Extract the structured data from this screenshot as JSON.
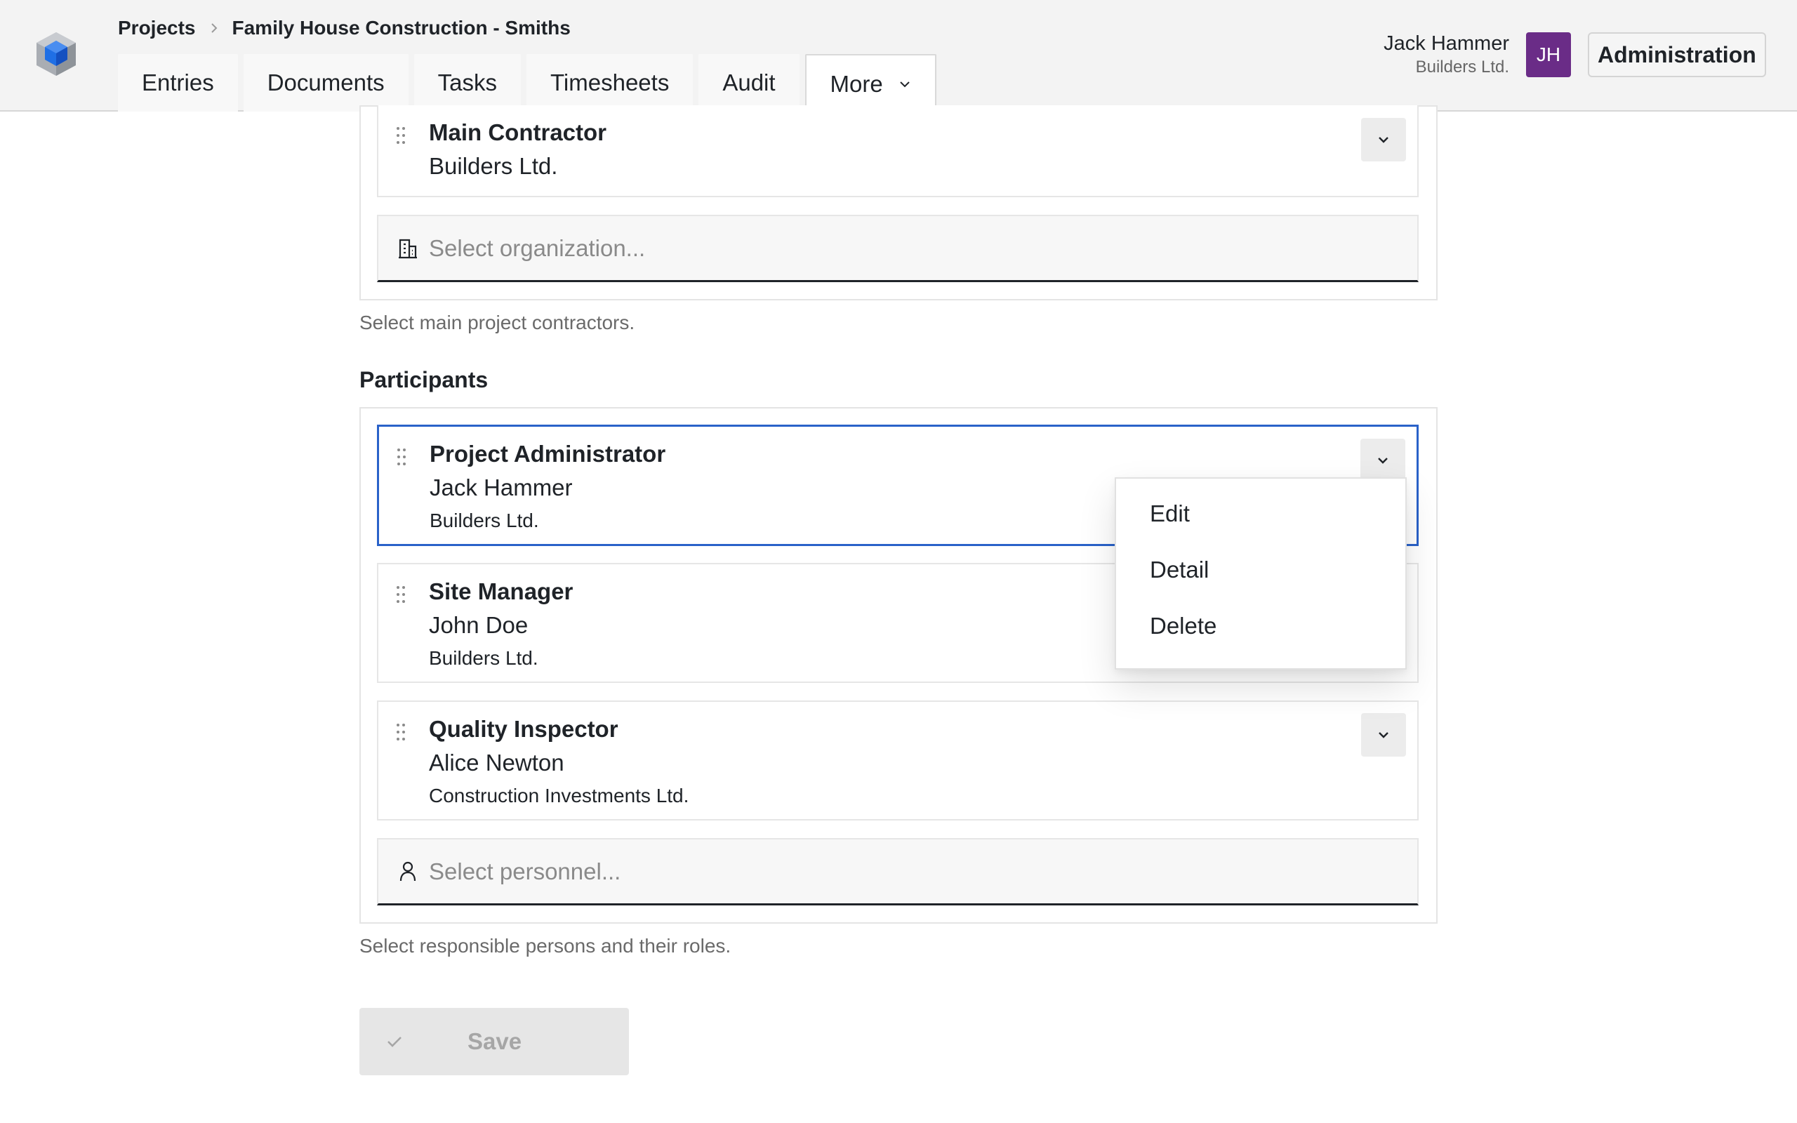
{
  "header": {
    "breadcrumb": {
      "root": "Projects",
      "current": "Family House Construction - Smiths"
    },
    "tabs": [
      {
        "label": "Entries"
      },
      {
        "label": "Documents"
      },
      {
        "label": "Tasks"
      },
      {
        "label": "Timesheets"
      },
      {
        "label": "Audit"
      },
      {
        "label": "More"
      }
    ],
    "user": {
      "name": "Jack Hammer",
      "org": "Builders Ltd.",
      "initials": "JH"
    },
    "admin_label": "Administration"
  },
  "contractors": {
    "items": [
      {
        "role": "Main Contractor",
        "org": "Builders Ltd."
      }
    ],
    "select_placeholder": "Select organization...",
    "hint": "Select main project contractors."
  },
  "participants": {
    "title": "Participants",
    "items": [
      {
        "role": "Project Administrator",
        "name": "Jack Hammer",
        "org": "Builders Ltd."
      },
      {
        "role": "Site Manager",
        "name": "John Doe",
        "org": "Builders Ltd."
      },
      {
        "role": "Quality Inspector",
        "name": "Alice Newton",
        "org": "Construction Investments Ltd."
      }
    ],
    "select_placeholder": "Select personnel...",
    "hint": "Select responsible persons and their roles."
  },
  "context_menu": {
    "items": [
      "Edit",
      "Detail",
      "Delete"
    ]
  },
  "save_label": "Save",
  "colors": {
    "accent": "#2a62c9",
    "avatar": "#6a2c87"
  }
}
